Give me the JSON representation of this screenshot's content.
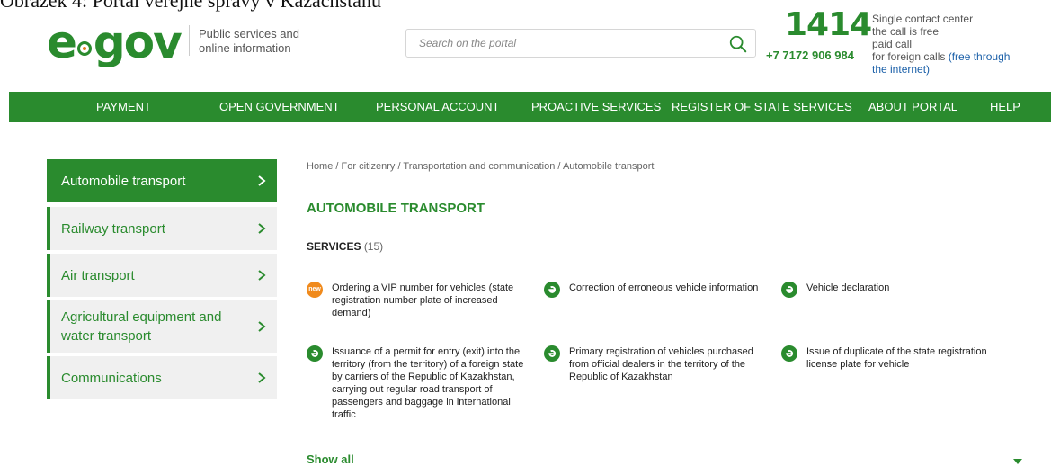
{
  "caption": "Obrázek 4: Portál veřejné správy v Kazachstánu",
  "header": {
    "logo_text_left": "e",
    "logo_text_right": "gov",
    "tagline": "Public services and online information",
    "search_placeholder": "Search on the portal",
    "call_number": "1414",
    "call_phone": "+7 7172 906 984",
    "call_info": [
      "Single contact center",
      "the call is free",
      "paid call",
      "for foreign calls"
    ],
    "call_link": "(free through the internet)",
    "call_link_parts": [
      "(free through",
      "the internet)"
    ]
  },
  "nav": {
    "items": [
      "PAYMENT",
      "OPEN GOVERNMENT",
      "PERSONAL ACCOUNT",
      "PROACTIVE SERVICES",
      "REGISTER OF STATE SERVICES",
      "ABOUT PORTAL",
      "HELP"
    ]
  },
  "sidebar": {
    "items": [
      {
        "label": "Automobile transport",
        "active": true
      },
      {
        "label": "Railway transport",
        "active": false
      },
      {
        "label": "Air transport",
        "active": false
      },
      {
        "label": "Agricultural equipment and water transport",
        "active": false
      },
      {
        "label": "Communications",
        "active": false
      }
    ]
  },
  "breadcrumb": [
    "Home",
    "For citizenry",
    "Transportation and communication",
    "Automobile transport"
  ],
  "main": {
    "title": "AUTOMOBILE TRANSPORT",
    "services_label": "SERVICES",
    "services_count": "(15)",
    "show_all": "Show all"
  },
  "services": [
    {
      "icon": "new-badge-icon",
      "badge": "new",
      "text": "Ordering a VIP number for vehicles (state registration number plate of increased demand)"
    },
    {
      "icon": "e-service-icon",
      "badge": "",
      "text": "Correction of erroneous vehicle information"
    },
    {
      "icon": "e-service-icon",
      "badge": "",
      "text": "Vehicle declaration"
    },
    {
      "icon": "e-service-icon",
      "badge": "",
      "text": "Issuance of a permit for entry (exit) into the territory (from the territory) of a foreign state by carriers of the Republic of Kazakhstan, carrying out regular road transport of passengers and baggage in international traffic"
    },
    {
      "icon": "e-service-icon",
      "badge": "",
      "text": "Primary registration of vehicles purchased from official dealers in the territory of the Republic of Kazakhstan"
    },
    {
      "icon": "e-service-icon",
      "badge": "",
      "text": "Issue of duplicate of the state registration license plate for vehicle"
    }
  ],
  "colors": {
    "brand_green": "#2a8b2e",
    "new_orange": "#f08a1c",
    "link_blue": "#1a5fa8"
  }
}
